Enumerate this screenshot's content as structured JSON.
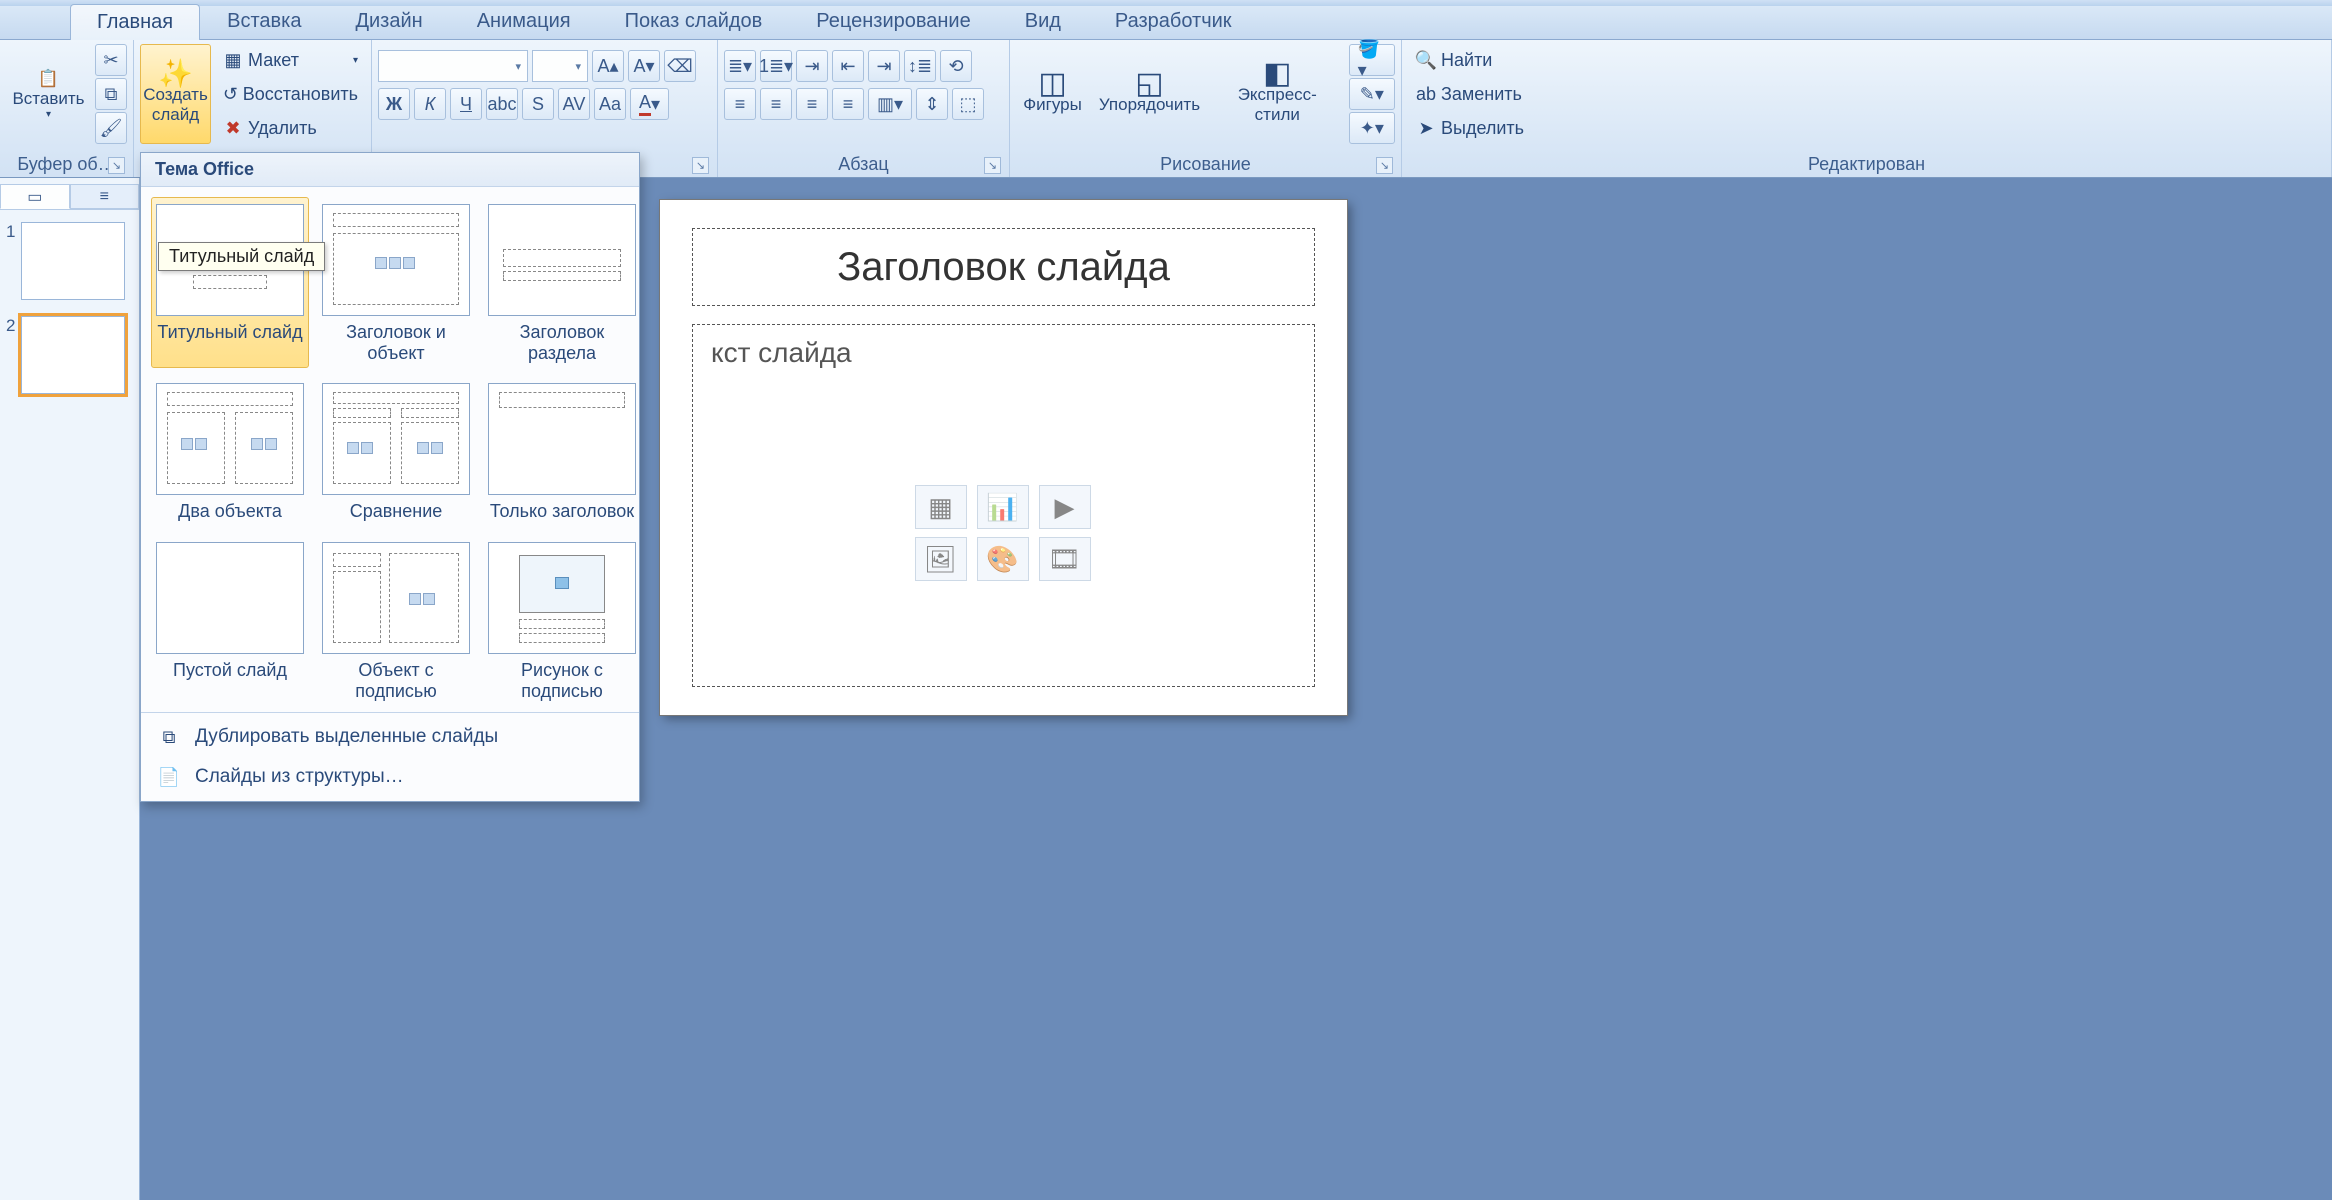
{
  "tabs": {
    "home": "Главная",
    "insert": "Вставка",
    "design": "Дизайн",
    "animation": "Анимация",
    "slideshow": "Показ слайдов",
    "review": "Рецензирование",
    "view": "Вид",
    "developer": "Разработчик"
  },
  "ribbon": {
    "clipboard": {
      "paste": "Вставить",
      "label": "Буфер об…"
    },
    "slides": {
      "new": "Создать\nслайд",
      "layout": "Макет",
      "reset": "Восстановить",
      "delete": "Удалить"
    },
    "paragraph": {
      "label": "Абзац"
    },
    "drawing": {
      "shapes": "Фигуры",
      "arrange": "Упорядочить",
      "quick": "Экспресс-стили",
      "label": "Рисование"
    },
    "editing": {
      "find": "Найти",
      "replace": "Заменить",
      "select": "Выделить",
      "label": "Редактирован"
    }
  },
  "layout_panel": {
    "header": "Тема Office",
    "tooltip": "Титульный слайд",
    "items": [
      "Титульный слайд",
      "Заголовок и объект",
      "Заголовок раздела",
      "Два объекта",
      "Сравнение",
      "Только заголовок",
      "Пустой слайд",
      "Объект с подписью",
      "Рисунок с подписью"
    ],
    "footer": {
      "duplicate": "Дублировать выделенные слайды",
      "outline": "Слайды из структуры…"
    }
  },
  "thumbs": {
    "n1": "1",
    "n2": "2"
  },
  "slide": {
    "title": "Заголовок слайда",
    "body": "кст слайда"
  }
}
